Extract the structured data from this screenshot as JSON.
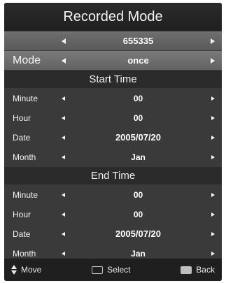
{
  "title": "Recorded Mode",
  "channel": {
    "value": "655335"
  },
  "mode": {
    "label": "Mode",
    "value": "once"
  },
  "start": {
    "section": "Start Time",
    "rows": [
      {
        "label": "Minute",
        "value": "00"
      },
      {
        "label": "Hour",
        "value": "00"
      },
      {
        "label": "Date",
        "value": "2005/07/20"
      },
      {
        "label": "Month",
        "value": "Jan"
      }
    ]
  },
  "end": {
    "section": "End Time",
    "rows": [
      {
        "label": "Minute",
        "value": "00"
      },
      {
        "label": "Hour",
        "value": "00"
      },
      {
        "label": "Date",
        "value": "2005/07/20"
      },
      {
        "label": "Month",
        "value": "Jan"
      }
    ]
  },
  "footer": {
    "move": "Move",
    "select": "Select",
    "back": "Back"
  }
}
